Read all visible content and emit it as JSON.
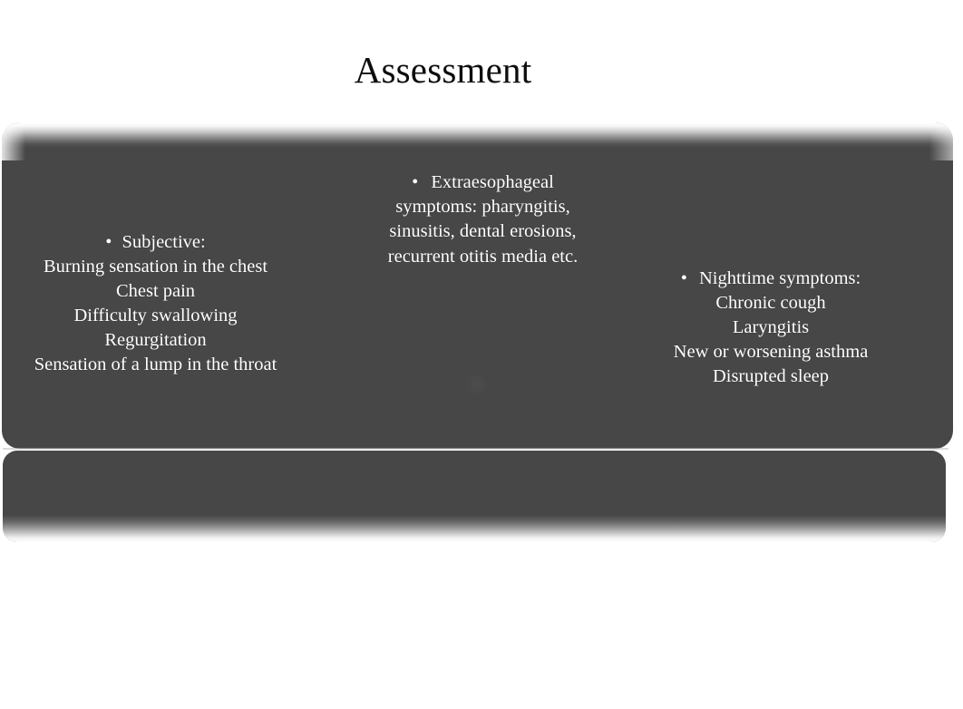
{
  "slide": {
    "title": "Assessment",
    "background_color": "#ffffff",
    "panel_color": "#474747",
    "text_color": "#ffffff",
    "title_color": "#0d0d0d"
  },
  "content": {
    "bullet_glyph": "•",
    "columns": [
      {
        "id": "subjective",
        "heading": "Subjective:",
        "lines": [
          "Burning sensation in the chest",
          "Chest pain",
          "Difficulty swallowing",
          "Regurgitation",
          "Sensation of a lump in the throat"
        ]
      },
      {
        "id": "extraesophageal",
        "heading": "Extraesophageal",
        "body": "symptoms: pharyngitis, sinusitis, dental erosions, recurrent otitis media etc."
      },
      {
        "id": "faded-bullet",
        "heading": "",
        "body": ""
      },
      {
        "id": "nighttime",
        "heading": "Nighttime symptoms:",
        "lines": [
          "Chronic cough",
          "Laryngitis",
          "New or worsening asthma",
          "Disrupted sleep"
        ]
      }
    ]
  }
}
